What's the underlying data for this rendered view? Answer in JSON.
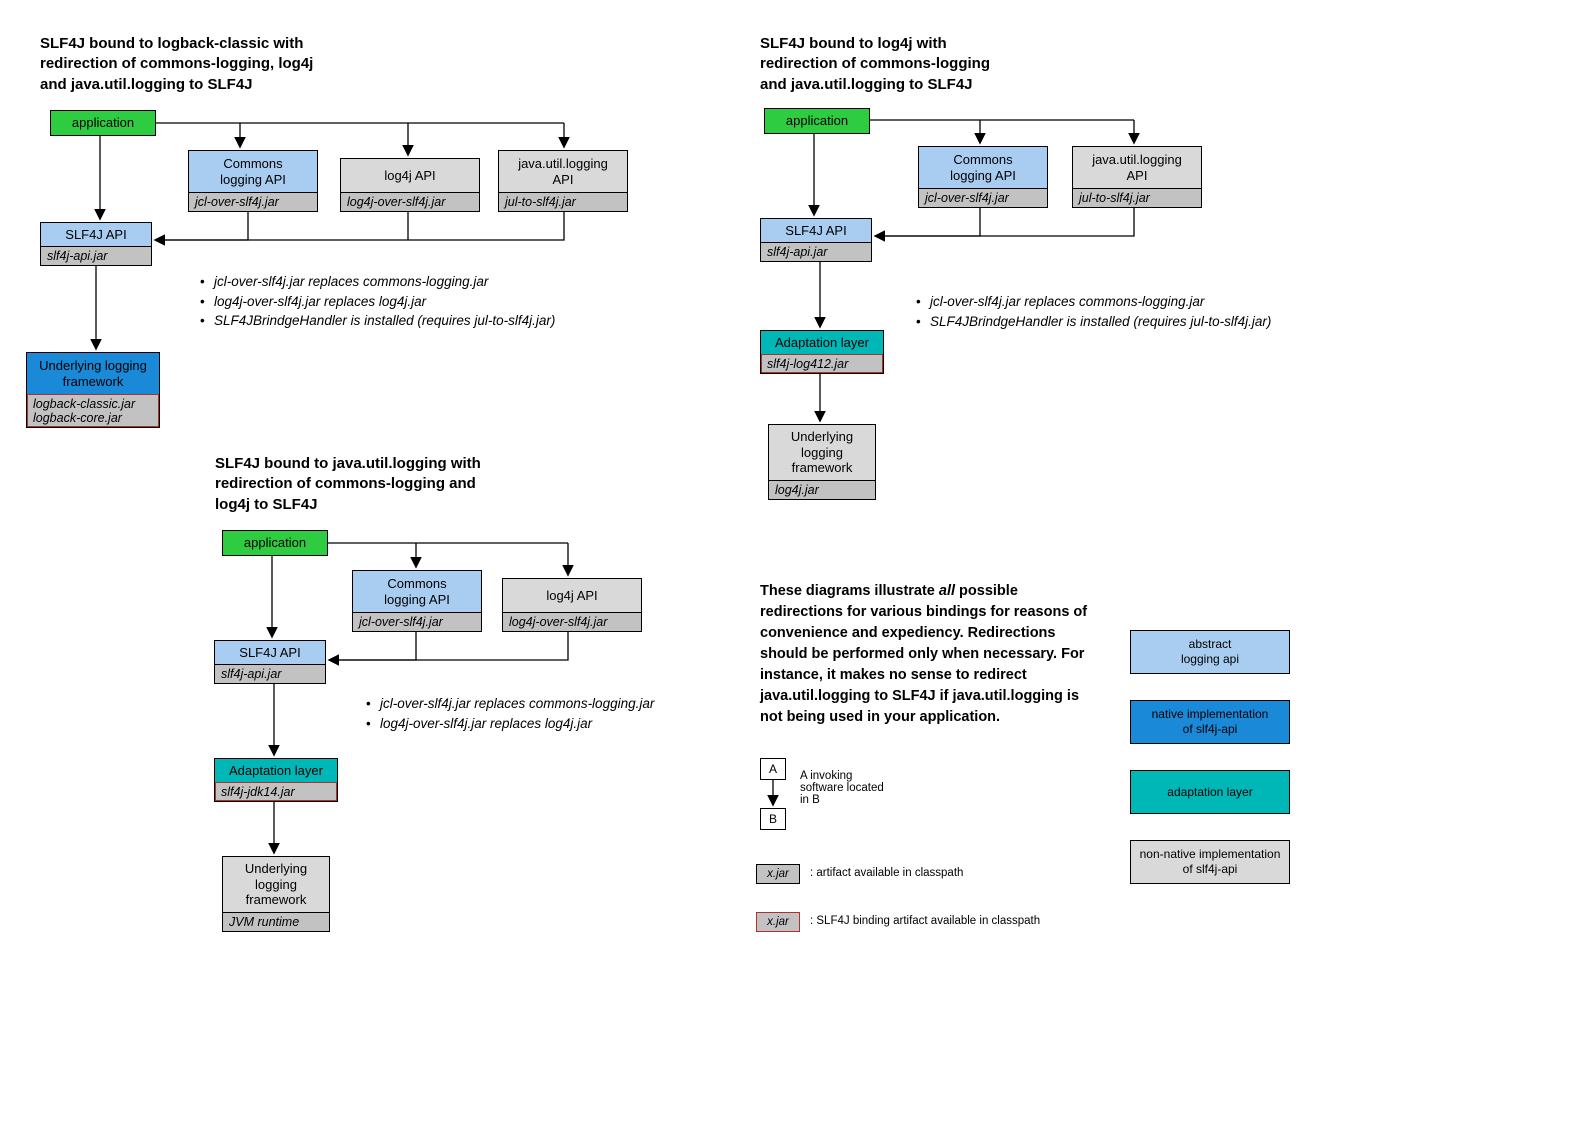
{
  "panels": {
    "logback": {
      "title": "SLF4J bound to logback-classic with\nredirection of commons-logging, log4j\nand java.util.logging to SLF4J",
      "app": "application",
      "commons": {
        "label": "Commons\nlogging API",
        "jar": "jcl-over-slf4j.jar"
      },
      "log4j": {
        "label": "log4j API",
        "jar": "log4j-over-slf4j.jar"
      },
      "jul": {
        "label": "java.util.logging\nAPI",
        "jar": "jul-to-slf4j.jar"
      },
      "slf4j": {
        "label": "SLF4J API",
        "jar": "slf4j-api.jar"
      },
      "underlying": {
        "label": "Underlying logging\nframework",
        "jar": "logback-classic.jar\nlogback-core.jar"
      },
      "notes": [
        "jcl-over-slf4j.jar replaces commons-logging.jar",
        "log4j-over-slf4j.jar replaces log4j.jar",
        "SLF4JBrindgeHandler is installed (requires jul-to-slf4j.jar)"
      ]
    },
    "jul": {
      "title": "SLF4J bound to java.util.logging with\nredirection of commons-logging and\nlog4j to SLF4J",
      "app": "application",
      "commons": {
        "label": "Commons\nlogging API",
        "jar": "jcl-over-slf4j.jar"
      },
      "log4j": {
        "label": "log4j API",
        "jar": "log4j-over-slf4j.jar"
      },
      "slf4j": {
        "label": "SLF4J API",
        "jar": "slf4j-api.jar"
      },
      "adapt": {
        "label": "Adaptation layer",
        "jar": "slf4j-jdk14.jar"
      },
      "underlying": {
        "label": "Underlying\nlogging\nframework",
        "jar": "JVM runtime"
      },
      "notes": [
        "jcl-over-slf4j.jar replaces commons-logging.jar",
        "log4j-over-slf4j.jar replaces log4j.jar"
      ]
    },
    "log4j": {
      "title": "SLF4J bound to log4j with\nredirection of commons-logging\nand java.util.logging to SLF4J",
      "app": "application",
      "commons": {
        "label": "Commons\nlogging API",
        "jar": "jcl-over-slf4j.jar"
      },
      "jul": {
        "label": "java.util.logging\nAPI",
        "jar": "jul-to-slf4j.jar"
      },
      "slf4j": {
        "label": "SLF4J API",
        "jar": "slf4j-api.jar"
      },
      "adapt": {
        "label": "Adaptation layer",
        "jar": "slf4j-log412.jar"
      },
      "underlying": {
        "label": "Underlying\nlogging\nframework",
        "jar": "log4j.jar"
      },
      "notes": [
        "jcl-over-slf4j.jar replaces commons-logging.jar",
        "SLF4JBrindgeHandler is installed (requires jul-to-slf4j.jar)"
      ]
    }
  },
  "paragraph": "These diagrams illustrate all possible redirections for various bindings for reasons of convenience and expediency. Redirections should be performed only when necessary. For instance, it makes no sense to redirect java.util.logging to SLF4J if java.util.logging is\nnot being used in your application.",
  "legend": {
    "ab": {
      "a": "A",
      "b": "B",
      "text": "A invoking\nsoftware located\nin B"
    },
    "artifact_plain": {
      "jar": "x.jar",
      "text": ": artifact available in classpath"
    },
    "artifact_red": {
      "jar": "x.jar",
      "text": ": SLF4J binding artifact available in classpath"
    },
    "colors": {
      "abstract": "abstract\nlogging api",
      "native": "native implementation\nof slf4j-api",
      "adapt": "adaptation layer",
      "nonnative": "non-native implementation\nof slf4j-api"
    }
  }
}
